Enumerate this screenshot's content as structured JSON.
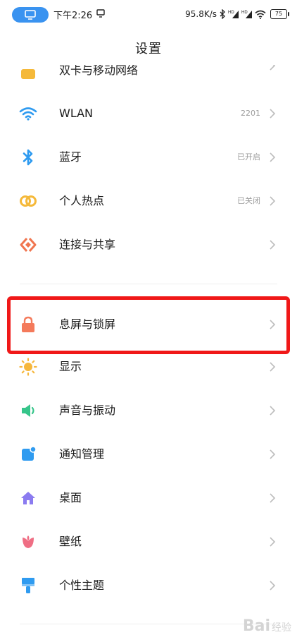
{
  "status_bar": {
    "time": "下午2:26",
    "network_speed": "95.8K/s",
    "battery_level": "75",
    "icons": [
      "screen-share-icon",
      "cast-icon",
      "bluetooth-icon",
      "signal-hd-icon",
      "signal-hd-icon",
      "wifi-icon",
      "battery-icon"
    ]
  },
  "header": {
    "title": "设置"
  },
  "partial_item": {
    "label": "双卡与移动网络",
    "icon": "sim-card-icon"
  },
  "group1": [
    {
      "label": "WLAN",
      "status": "2201",
      "icon": "wifi-icon",
      "color": "#2f9bf0"
    },
    {
      "label": "蓝牙",
      "status": "已开启",
      "icon": "bluetooth-icon",
      "color": "#2f9bf0"
    },
    {
      "label": "个人热点",
      "status": "已关闭",
      "icon": "hotspot-icon",
      "color": "#f5b93a"
    },
    {
      "label": "连接与共享",
      "status": "",
      "icon": "connection-share-icon",
      "color": "#f0754f"
    }
  ],
  "group2": [
    {
      "label": "息屏与锁屏",
      "status": "",
      "icon": "lock-icon",
      "color": "#f47a5b"
    },
    {
      "label": "显示",
      "status": "",
      "icon": "sun-icon",
      "color": "#f6b73c"
    },
    {
      "label": "声音与振动",
      "status": "",
      "icon": "speaker-icon",
      "color": "#36c58a"
    },
    {
      "label": "通知管理",
      "status": "",
      "icon": "notification-icon",
      "color": "#2f9bf0"
    },
    {
      "label": "桌面",
      "status": "",
      "icon": "home-icon",
      "color": "#8b7bf0"
    },
    {
      "label": "壁纸",
      "status": "",
      "icon": "flower-icon",
      "color": "#ef6e84"
    },
    {
      "label": "个性主题",
      "status": "",
      "icon": "paint-brush-icon",
      "color": "#2f9bf0"
    }
  ],
  "highlighted_item": "息屏与锁屏",
  "watermark": {
    "brand": "Bai",
    "suffix": "经验"
  }
}
